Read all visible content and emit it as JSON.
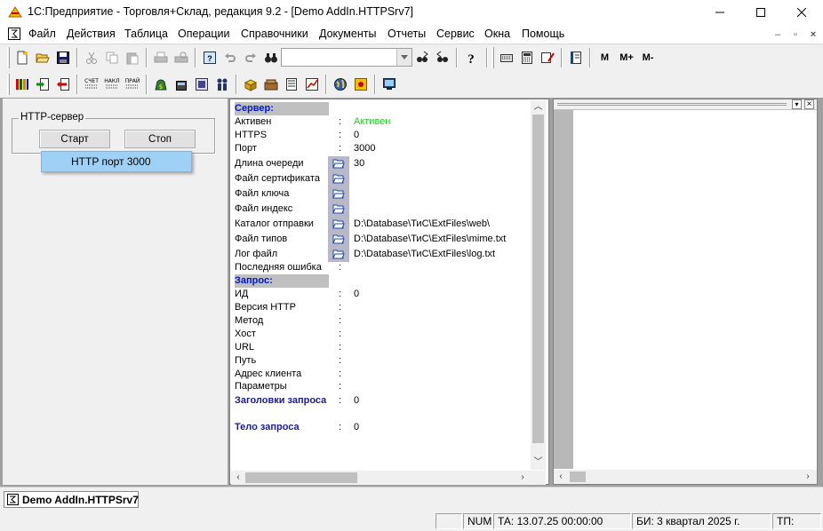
{
  "window": {
    "title": "1С:Предприятие - Торговля+Склад, редакция 9.2 - [Demo AddIn.HTTPSrv7]",
    "minimize_icon": "minimize-icon",
    "maximize_icon": "maximize-icon",
    "close_icon": "close-icon"
  },
  "menu": [
    "Файл",
    "Действия",
    "Таблица",
    "Операции",
    "Справочники",
    "Документы",
    "Отчеты",
    "Сервис",
    "Окна",
    "Помощь"
  ],
  "toolbar": {
    "combo_value": "",
    "memory_buttons": [
      "M",
      "M+",
      "M-"
    ]
  },
  "left_panel": {
    "group_label": "HTTP-сервер",
    "start_button": "Старт",
    "stop_button": "Стоп",
    "dropdown_item": "HTTP порт 3000"
  },
  "server": {
    "header": "Сервер:",
    "active_label": "Активен",
    "active_value": "Активен",
    "https_label": "HTTPS",
    "https_value": "0",
    "port_label": "Порт",
    "port_value": "3000",
    "queue_label": "Длина очереди",
    "queue_value": "30",
    "cert_label": "Файл сертификата",
    "cert_value": "",
    "key_label": "Файл ключа",
    "key_value": "",
    "index_label": "Файл индекс",
    "index_value": "",
    "catalog_label": "Каталог отправки",
    "catalog_value": "D:\\Database\\ТиС\\ExtFiles\\web\\",
    "types_label": "Файл типов",
    "types_value": "D:\\Database\\ТиС\\ExtFiles\\mime.txt",
    "log_label": "Лог файл",
    "log_value": "D:\\Database\\ТиС\\ExtFiles\\log.txt",
    "last_error_label": "Последняя ошибка",
    "last_error_value": ""
  },
  "request": {
    "header": "Запрос:",
    "id_label": "ИД",
    "id_value": "0",
    "http_version_label": "Версия HTTP",
    "http_version_value": "",
    "method_label": "Метод",
    "method_value": "",
    "host_label": "Хост",
    "host_value": "",
    "url_label": "URL",
    "url_value": "",
    "path_label": "Путь",
    "path_value": "",
    "client_label": "Адрес клиента",
    "client_value": "",
    "params_label": "Параметры",
    "params_value": "",
    "headers_label": "Заголовки запроса",
    "headers_value": "0",
    "body_label": "Тело запроса",
    "body_value": "0"
  },
  "colon": ":",
  "taskbar": {
    "item": "Demo AddIn.HTTPSrv7"
  },
  "status": {
    "num": "NUM",
    "ta": "ТА: 13.07.25  00:00:00",
    "bi": "БИ: 3 квартал 2025 г.",
    "tp": "ТП:"
  },
  "colors": {
    "active_green": "#22cc22",
    "header_blue": "#0018c8",
    "dropdown_highlight": "#9fd0f5"
  }
}
